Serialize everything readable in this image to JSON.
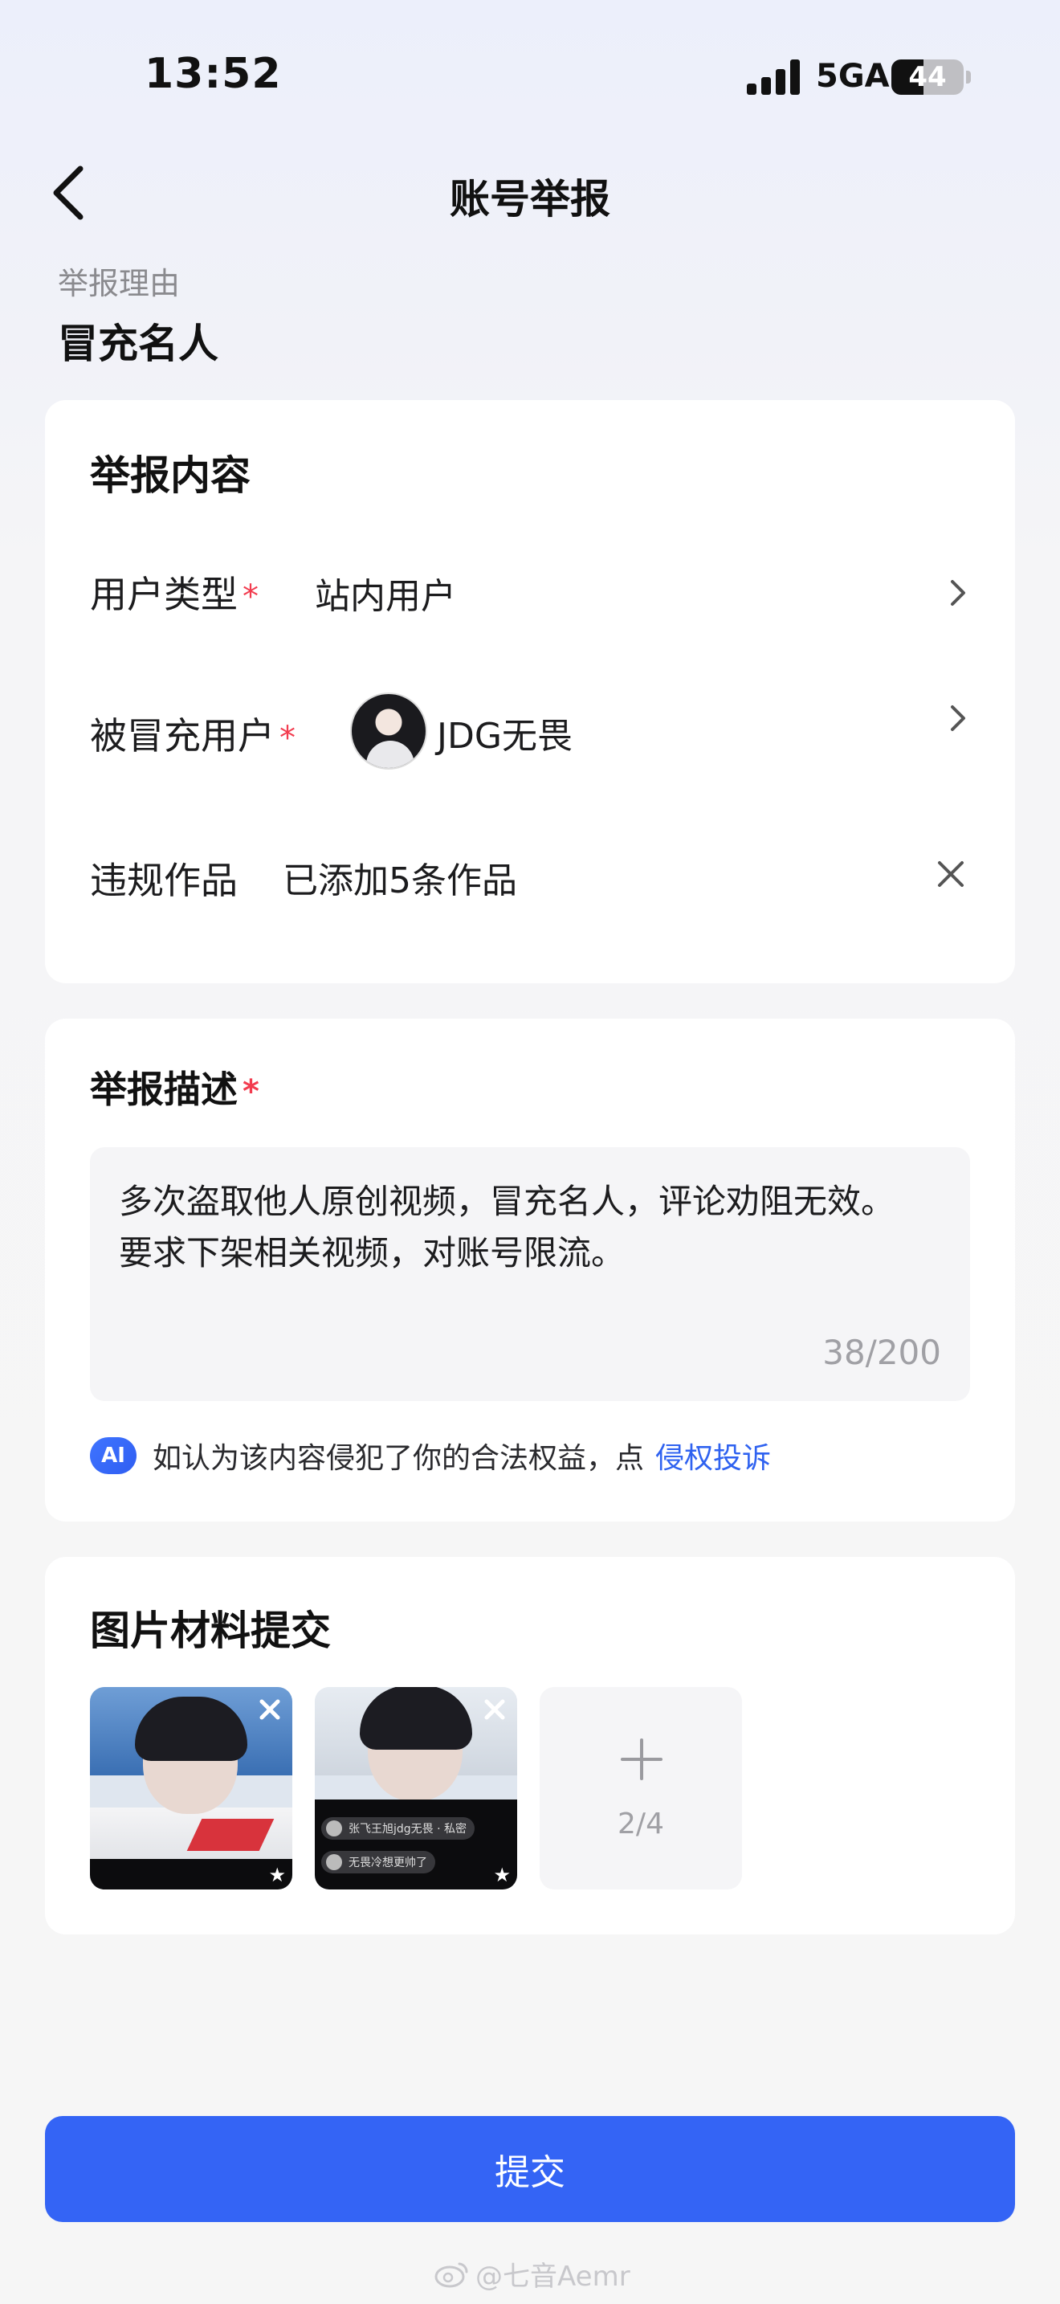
{
  "status_bar": {
    "time": "13:52",
    "network": "5GA",
    "battery_level": "44"
  },
  "nav": {
    "title": "账号举报"
  },
  "report_reason": {
    "label": "举报理由",
    "value": "冒充名人"
  },
  "report_content": {
    "title": "举报内容",
    "user_type": {
      "label": "用户类型",
      "required_mark": "*",
      "value": "站内用户"
    },
    "impersonated_user": {
      "label": "被冒充用户",
      "required_mark": "*",
      "name": "JDG无畏"
    },
    "violating_works": {
      "label": "违规作品",
      "value": "已添加5条作品"
    }
  },
  "description": {
    "title": "举报描述",
    "required_mark": "*",
    "text": "多次盗取他人原创视频，冒充名人，评论劝阻无效。要求下架相关视频，对账号限流。",
    "count": "38/200",
    "ai_badge": "AI",
    "tip_text": "如认为该内容侵犯了你的合法权益，点",
    "tip_link": "侵权投诉"
  },
  "images": {
    "title": "图片材料提交",
    "count": "2/4",
    "thumb2_comments": [
      "张飞王旭jdg无畏 · 私密",
      "无畏冷想更帅了"
    ]
  },
  "submit_label": "提交",
  "watermark": "@七音Aemr",
  "colors": {
    "accent": "#3464f5",
    "required": "#f23c4f",
    "link": "#2f62f0"
  }
}
